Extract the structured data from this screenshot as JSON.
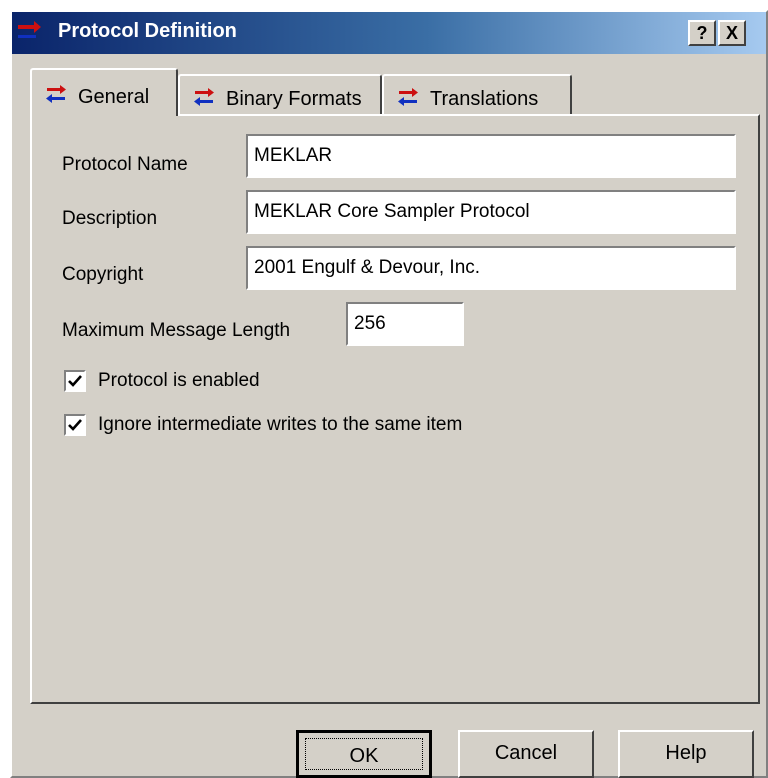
{
  "window": {
    "title": "Protocol Definition",
    "help_glyph": "?",
    "close_glyph": "X"
  },
  "tabs": [
    {
      "label": "General",
      "active": true,
      "icon": "protocol-arrows-icon"
    },
    {
      "label": "Binary Formats",
      "active": false,
      "icon": "protocol-arrows-icon"
    },
    {
      "label": "Translations",
      "active": false,
      "icon": "protocol-arrows-icon"
    }
  ],
  "form": {
    "protocol_name": {
      "label": "Protocol Name",
      "value": "MEKLAR"
    },
    "description": {
      "label": "Description",
      "value": "MEKLAR Core Sampler Protocol"
    },
    "copyright": {
      "label": "Copyright",
      "value": "2001 Engulf & Devour, Inc."
    },
    "max_length": {
      "label": "Maximum Message Length",
      "value": "256"
    }
  },
  "checkboxes": [
    {
      "label": "Protocol is enabled",
      "checked": true
    },
    {
      "label": "Ignore intermediate writes to the same item",
      "checked": true
    }
  ],
  "buttons": {
    "ok": "OK",
    "cancel": "Cancel",
    "help": "Help"
  },
  "colors": {
    "titlebar_start": "#0a246a",
    "titlebar_end": "#a6caf0",
    "face": "#d4d0c8",
    "icon_red": "#cc1010",
    "icon_blue": "#1030c0"
  }
}
